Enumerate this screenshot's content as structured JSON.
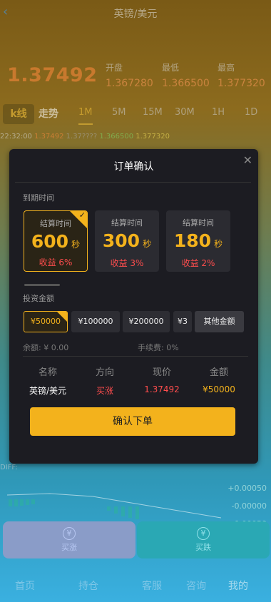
{
  "header": {
    "title": "英镑/美元",
    "back_icon": "chevron-left-icon"
  },
  "quote": {
    "price": "1.37492",
    "stats": [
      {
        "label": "开盘",
        "value": "1.367280"
      },
      {
        "label": "最低",
        "value": "1.366500"
      },
      {
        "label": "最高",
        "value": "1.377320"
      }
    ]
  },
  "chart_tabs": {
    "kline": "k线",
    "trend": "走势",
    "periods": [
      "1M",
      "5M",
      "15M",
      "30M",
      "1H",
      "1D"
    ],
    "active": "1M"
  },
  "quote_line": {
    "time": "22:32:00",
    "v1": "1.37492",
    "v2": "1.37????",
    "v3": "1.366500",
    "v4": "1.377320"
  },
  "indicator": {
    "diff": "DIFF: ",
    "axis_top": "+0.00050",
    "axis_mid": "-0.00000",
    "axis_bot": "-0.00050"
  },
  "trade_buttons": {
    "up": "买涨",
    "down": "买跌"
  },
  "nav": [
    "首页",
    "持仓",
    "客服",
    "咨询",
    "我的"
  ],
  "modal": {
    "title": "订单确认",
    "expiry_label": "到期时间",
    "time_options": [
      {
        "label": "结算时间",
        "seconds": "600",
        "unit": "秒",
        "yield": "收益 6%",
        "selected": true
      },
      {
        "label": "结算时间",
        "seconds": "300",
        "unit": "秒",
        "yield": "收益 3%",
        "selected": false
      },
      {
        "label": "结算时间",
        "seconds": "180",
        "unit": "秒",
        "yield": "收益 2%",
        "selected": false
      }
    ],
    "invest_label": "投资金额",
    "amounts": [
      "¥50000",
      "¥100000",
      "¥200000",
      "¥3"
    ],
    "other_amount": "其他金额",
    "balance_label": "余额:",
    "balance_value": "¥ 0.00",
    "fee_label": "手续费:",
    "fee_value": "0%",
    "columns": [
      "名称",
      "方向",
      "现价",
      "金额"
    ],
    "row": {
      "name": "英镑/美元",
      "direction": "买涨",
      "price": "1.37492",
      "amount": "¥50000"
    },
    "confirm_label": "确认下单"
  },
  "colors": {
    "accent": "#f3b21c",
    "up": "#ff4d4d",
    "bg_modal": "#1c1c22"
  }
}
